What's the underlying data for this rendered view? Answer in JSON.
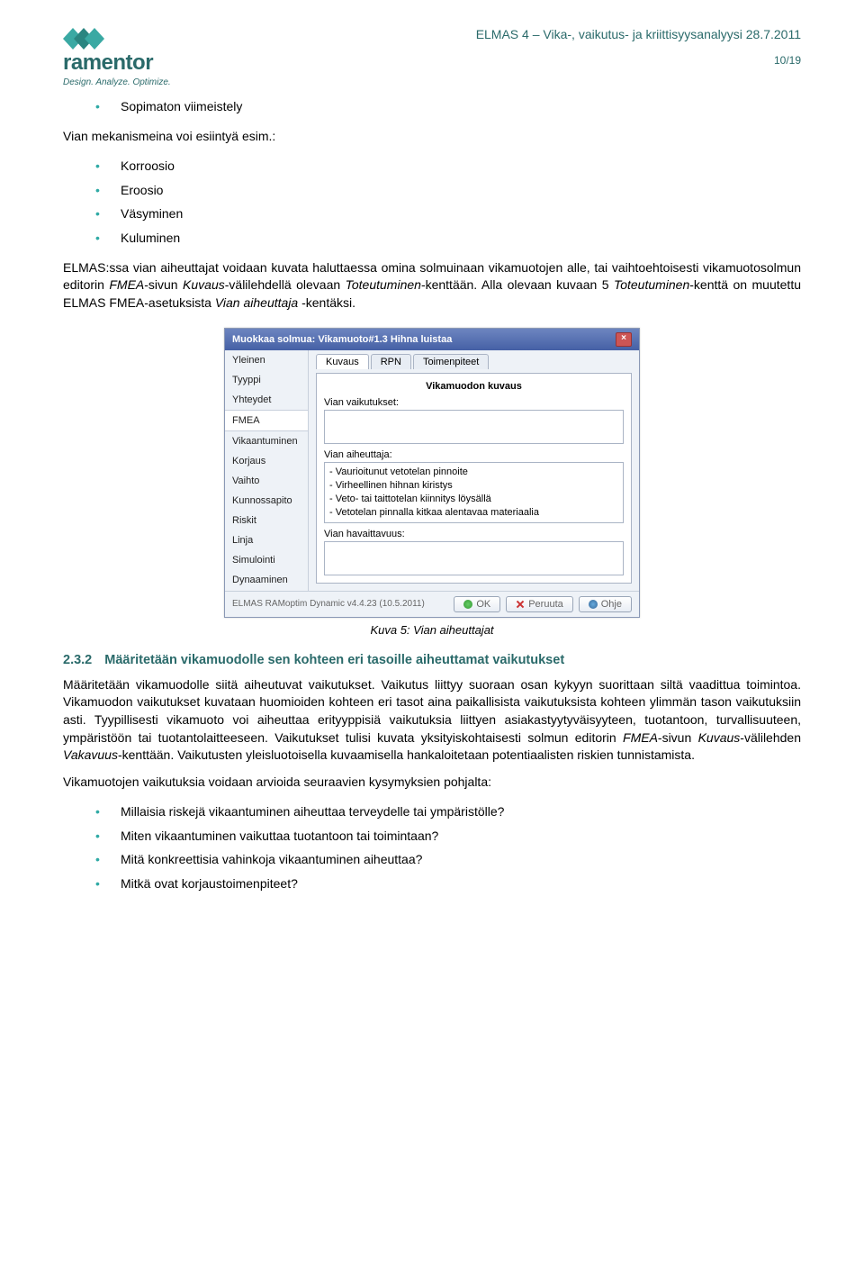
{
  "header": {
    "logo_name": "ramentor",
    "logo_tagline": "Design. Analyze. Optimize.",
    "doc_title": "ELMAS 4 – Vika-, vaikutus- ja kriittisyysanalyysi 28.7.2011",
    "page_num": "10/19"
  },
  "list1": [
    "Sopimaton viimeistely"
  ],
  "intro_line": "Vian mekanismeina voi esiintyä esim.:",
  "list2": [
    "Korroosio",
    "Eroosio",
    "Väsyminen",
    "Kuluminen"
  ],
  "para1_plain1": "ELMAS:ssa vian aiheuttajat voidaan kuvata haluttaessa omina solmuinaan vikamuotojen alle, tai vaihtoehtoisesti vikamuotosolmun editorin ",
  "para1_em1": "FMEA",
  "para1_plain2": "-sivun ",
  "para1_em2": "Kuvaus",
  "para1_plain3": "-välilehdellä olevaan ",
  "para1_em3": "Toteutuminen",
  "para1_plain4": "-kenttään. Alla olevaan kuvaan 5 ",
  "para1_em4": "Toteutuminen",
  "para1_plain5": "-kenttä on muutettu ELMAS FMEA-asetuksista ",
  "para1_em5": "Vian aiheuttaja",
  "para1_plain6": " -kentäksi.",
  "dialog": {
    "title": "Muokkaa solmua: Vikamuoto#1.3 Hihna luistaa",
    "sidebar": [
      "Yleinen",
      "Tyyppi",
      "Yhteydet",
      "FMEA",
      "Vikaantuminen",
      "Korjaus",
      "Vaihto",
      "Kunnossapito",
      "Riskit",
      "Linja",
      "Simulointi",
      "Dynaaminen"
    ],
    "sidebar_selected_index": 3,
    "tabs": [
      "Kuvaus",
      "RPN",
      "Toimenpiteet"
    ],
    "active_tab_index": 0,
    "pane_title": "Vikamuodon kuvaus",
    "label_effects": "Vian vaikutukset:",
    "label_cause": "Vian aiheuttaja:",
    "cause_lines": [
      "- Vaurioitunut vetotelan pinnoite",
      "- Virheellinen hihnan kiristys",
      "- Veto- tai taittotelan kiinnitys löysällä",
      "- Vetotelan pinnalla kitkaa alentavaa materiaalia"
    ],
    "label_detect": "Vian havaittavuus:",
    "footer_version": "ELMAS RAMoptim Dynamic v4.4.23 (10.5.2011)",
    "btn_ok": "OK",
    "btn_cancel": "Peruuta",
    "btn_help": "Ohje"
  },
  "caption": "Kuva 5: Vian aiheuttajat",
  "h3_num": "2.3.2",
  "h3_text": "Määritetään vikamuodolle sen kohteen eri tasoille aiheuttamat vaikutukset",
  "para2_a": "Määritetään vikamuodolle siitä aiheutuvat vaikutukset. Vaikutus liittyy suoraan osan kykyyn suorittaan siltä vaadittua toimintoa. Vikamuodon vaikutukset kuvataan huomioiden kohteen eri tasot aina paikallisista vaikutuksista kohteen ylimmän tason vaikutuksiin asti.  Tyypillisesti vikamuoto voi aiheuttaa erityyppisiä vaikutuksia liittyen asiakastyytyväisyyteen, tuotantoon, turvallisuuteen, ympäristöön tai tuotantolaitteeseen. Vaikutukset tulisi kuvata yksityiskohtaisesti solmun editorin ",
  "para2_em1": "FMEA",
  "para2_mid1": "-sivun ",
  "para2_em2": "Kuvaus",
  "para2_mid2": "-välilehden ",
  "para2_em3": "Vakavuus",
  "para2_b": "-kenttään. Vaikutusten yleisluotoisella kuvaamisella hankaloitetaan potentiaalisten riskien tunnistamista.",
  "para3": "Vikamuotojen vaikutuksia voidaan arvioida seuraavien kysymyksien pohjalta:",
  "list3": [
    "Millaisia riskejä vikaantuminen aiheuttaa terveydelle tai ympäristölle?",
    "Miten vikaantuminen vaikuttaa tuotantoon tai toimintaan?",
    "Mitä konkreettisia vahinkoja vikaantuminen aiheuttaa?",
    "Mitkä ovat korjaustoimenpiteet?"
  ]
}
